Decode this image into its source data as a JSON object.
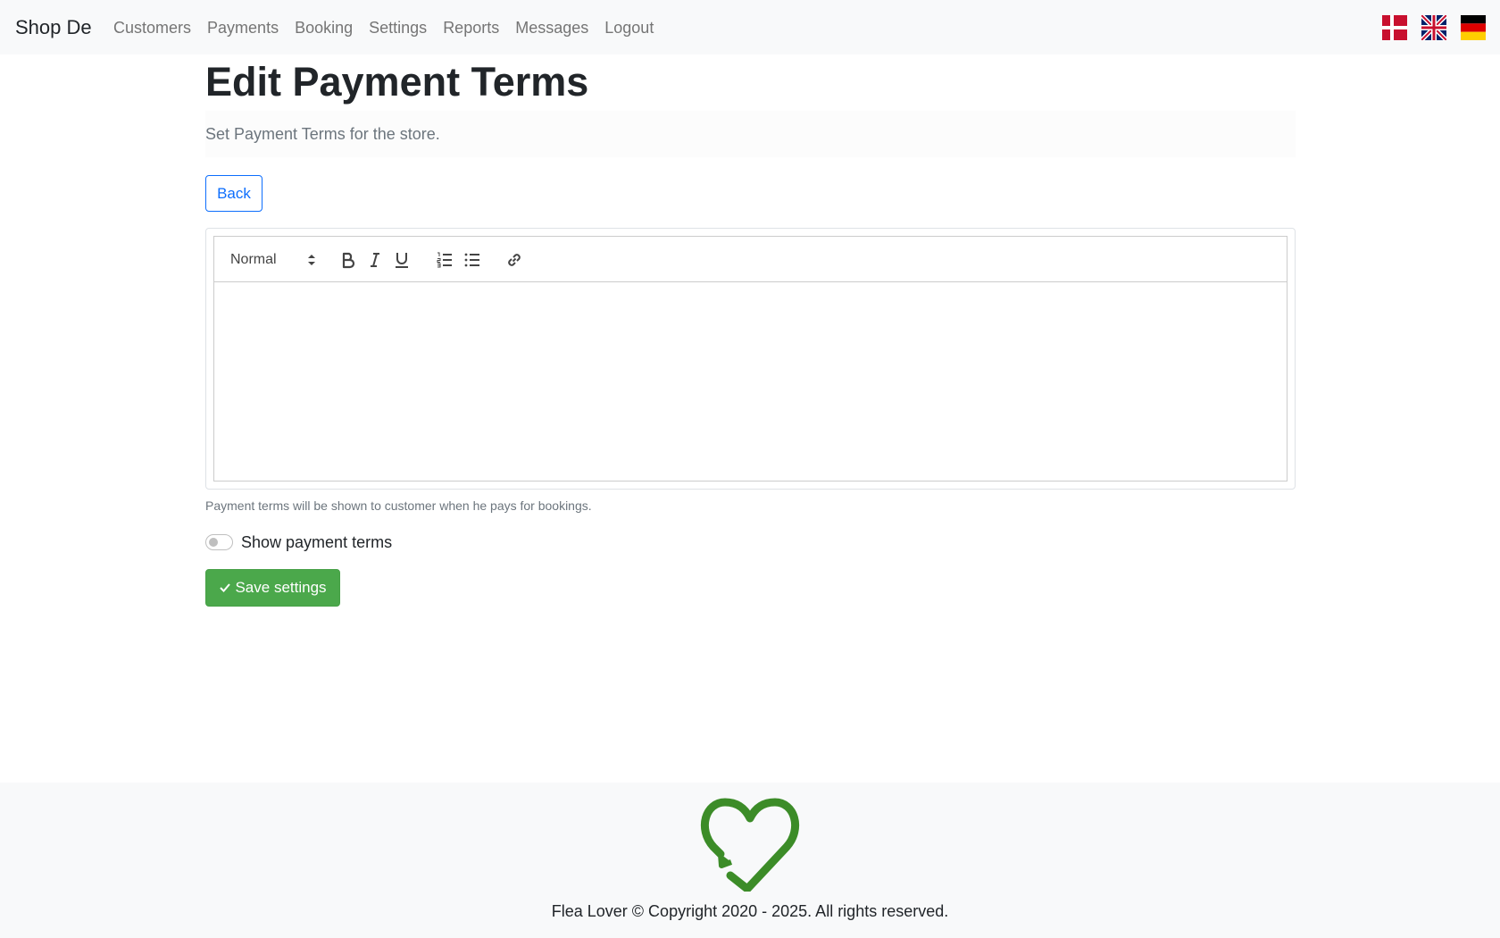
{
  "navbar": {
    "brand": "Shop De",
    "links": [
      {
        "label": "Customers"
      },
      {
        "label": "Payments"
      },
      {
        "label": "Booking"
      },
      {
        "label": "Settings"
      },
      {
        "label": "Reports"
      },
      {
        "label": "Messages"
      },
      {
        "label": "Logout"
      }
    ],
    "flags": [
      {
        "icon": "danish-flag-icon"
      },
      {
        "icon": "uk-flag-icon"
      },
      {
        "icon": "german-flag-icon"
      }
    ]
  },
  "page": {
    "title": "Edit Payment Terms",
    "lead": "Set Payment Terms for the store.",
    "back_label": "Back"
  },
  "editor": {
    "format_select": "Normal",
    "tools": [
      "bold-icon",
      "italic-icon",
      "underline-icon",
      "ordered-list-icon",
      "bullet-list-icon",
      "link-icon"
    ],
    "content": ""
  },
  "form": {
    "help_text": "Payment terms will be shown to customer when he pays for bookings.",
    "toggle_label": "Show payment terms",
    "toggle_on": false,
    "save_label": "Save settings"
  },
  "footer": {
    "logo_icon": "recycle-heart-logo",
    "copyright": "Flea Lover © Copyright 2020 - 2025. All rights reserved."
  },
  "colors": {
    "accent_blue": "#0d6efd",
    "success_green": "#4ba84b",
    "logo_green": "#3c8c28"
  }
}
